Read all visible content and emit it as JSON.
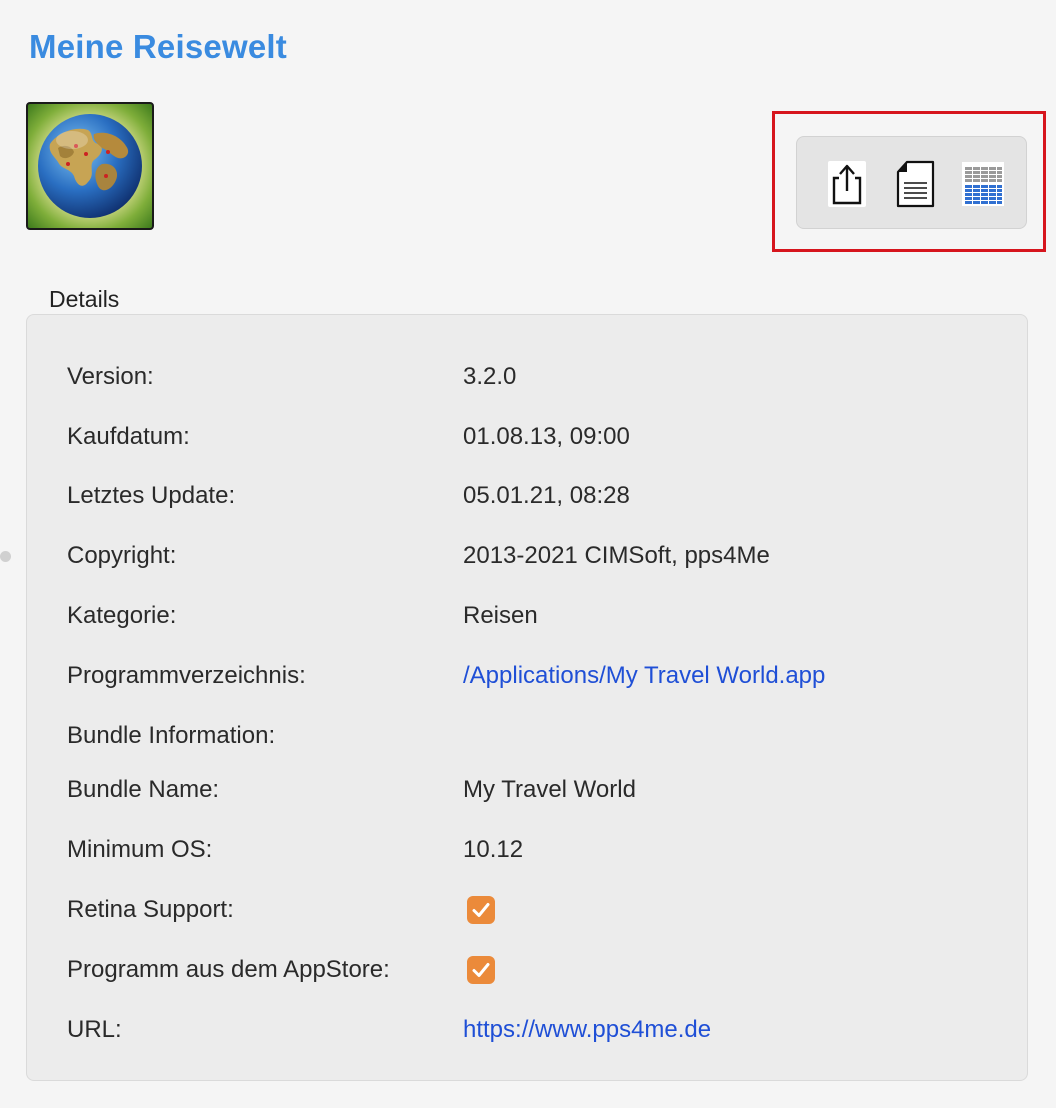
{
  "app": {
    "title": "Meine Reisewelt"
  },
  "toolbar": {
    "buttons": [
      "share-icon",
      "document-icon",
      "table-icon"
    ]
  },
  "details": {
    "label": "Details",
    "rows": [
      {
        "key": "Version:",
        "value": "3.2.0"
      },
      {
        "key": "Kaufdatum:",
        "value": "01.08.13, 09:00"
      },
      {
        "key": "Letztes Update:",
        "value": "05.01.21, 08:28"
      },
      {
        "key": "Copyright:",
        "value": "2013-2021 CIMSoft, pps4Me"
      },
      {
        "key": "Kategorie:",
        "value": "Reisen"
      },
      {
        "key": "Programmverzeichnis:",
        "value": "/Applications/My Travel World.app"
      },
      {
        "key": "Bundle Information:",
        "value": ""
      },
      {
        "key": "Bundle Name:",
        "value": "My Travel World"
      },
      {
        "key": "Minimum OS:",
        "value": "10.12"
      },
      {
        "key": "Retina Support:",
        "checked": true
      },
      {
        "key": "Programm aus dem AppStore:",
        "checked": true
      },
      {
        "key": "URL:",
        "value": "https://www.pps4me.de"
      }
    ]
  },
  "colors": {
    "title": "#3a8be0",
    "link": "#1f4fd6",
    "checkbox": "#eb8a3a",
    "highlight": "#d6151d"
  }
}
